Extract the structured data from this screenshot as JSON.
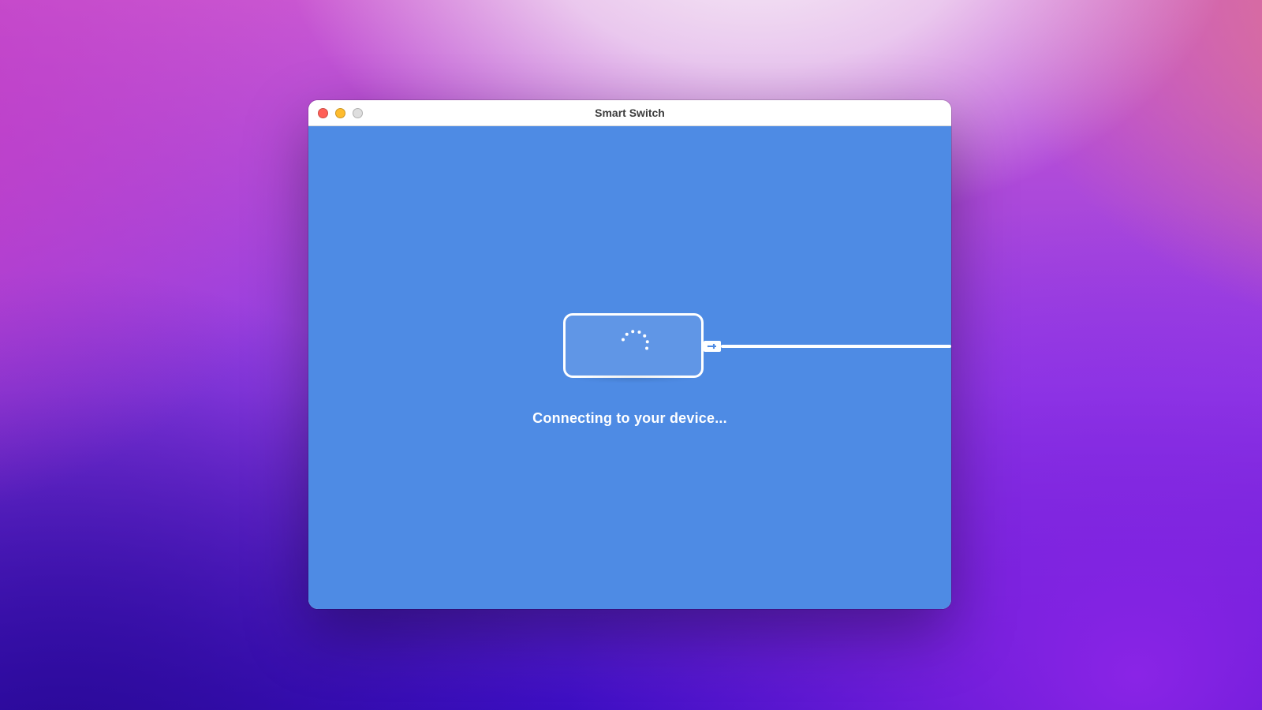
{
  "window": {
    "title": "Smart Switch"
  },
  "main": {
    "status_text": "Connecting to your device...",
    "colors": {
      "content_bg": "#4e8be4",
      "stroke": "#ffffff"
    }
  }
}
